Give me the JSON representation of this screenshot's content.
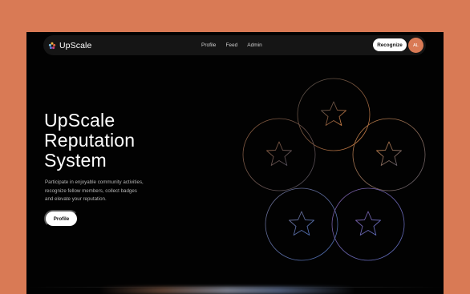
{
  "brand": {
    "name": "UpScale",
    "icon": "sparkle-logo-icon"
  },
  "nav": {
    "links": [
      "Profile",
      "Feed",
      "Admin"
    ]
  },
  "actions": {
    "recognize_label": "Recognize",
    "avatar_initials": "AL"
  },
  "hero": {
    "title_lines": [
      "UpScale",
      "Reputation",
      "System"
    ],
    "description_lines": [
      "Participate in enjoyable community activities,",
      "recognize fellow members, collect badges",
      "and elevate your reputation."
    ],
    "cta_label": "Profile"
  },
  "colors": {
    "background": "#d97a55",
    "frame": "#020202",
    "navbar": "#151515",
    "accent": "#d97a55",
    "button": "#ffffff"
  }
}
